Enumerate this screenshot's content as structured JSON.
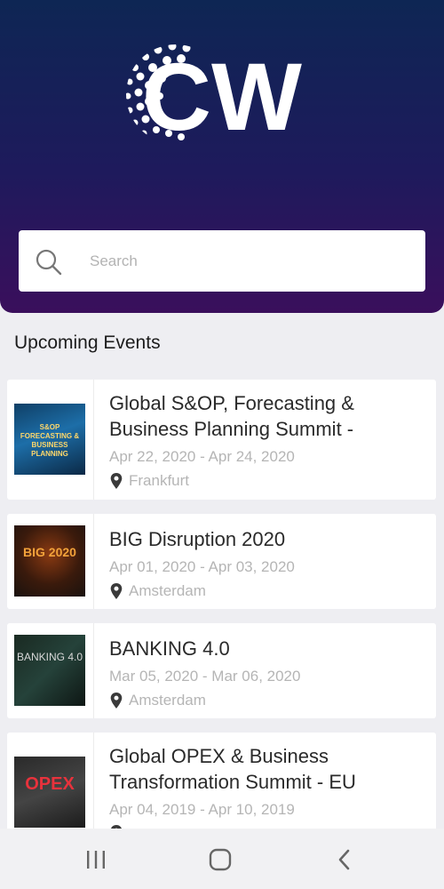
{
  "header": {
    "logo_text": "CW"
  },
  "search": {
    "placeholder": "Search"
  },
  "section_title": "Upcoming Events",
  "events": [
    {
      "title": " Global S&OP, Forecasting & Business Planning Summit -",
      "dates": "Apr 22, 2020 - Apr 24, 2020",
      "location": "Frankfurt",
      "thumb_text": "S&OP FORECASTING & BUSINESS PLANNING"
    },
    {
      "title": " BIG Disruption 2020",
      "dates": "Apr 01, 2020 - Apr 03, 2020",
      "location": "Amsterdam",
      "thumb_text": "BIG 2020"
    },
    {
      "title": "BANKING 4.0",
      "dates": "Mar 05, 2020 - Mar 06, 2020",
      "location": "Amsterdam",
      "thumb_text": "BANKING 4.0"
    },
    {
      "title": "Global OPEX & Business Transformation Summit - EU",
      "dates": "Apr 04, 2019 - Apr 10, 2019",
      "location": "",
      "thumb_text": "OPEX"
    }
  ],
  "colors": {
    "header_top": "#0e2654",
    "header_bottom": "#3a0f5c",
    "background": "#eeeef2",
    "muted_text": "#b5b5b5"
  },
  "icons": [
    "search-icon",
    "location-pin-icon",
    "recent-apps-icon",
    "home-icon",
    "back-icon"
  ]
}
